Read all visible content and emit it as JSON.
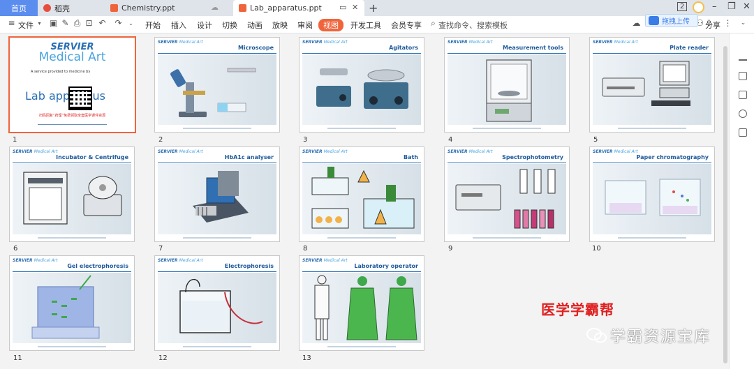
{
  "tabs": {
    "home": "首页",
    "daoke": "稻壳",
    "doc1": "Chemistry.ppt",
    "doc2": "Lab_apparatus.ppt"
  },
  "titlebar": {
    "badge": "2"
  },
  "ribbon": {
    "file": "文件",
    "tabs": [
      "开始",
      "插入",
      "设计",
      "切换",
      "动画",
      "放映",
      "审阅",
      "视图",
      "开发工具",
      "会员专享"
    ],
    "active_tab": "视图",
    "search_placeholder": "查找命令、搜索模板",
    "upload_label": "拖拽上传",
    "share": "分享"
  },
  "cover": {
    "servier": "SERVIER",
    "medical_art": "Medical Art",
    "tagline": "A service provided to medicine by",
    "lab_title": "Lab apparatus",
    "promo": "扫码回复“药理”免费领取全套医学课件资源"
  },
  "slides": [
    {
      "num": "1",
      "title": ""
    },
    {
      "num": "2",
      "title": "Microscope"
    },
    {
      "num": "3",
      "title": "Agitators"
    },
    {
      "num": "4",
      "title": "Measurement tools"
    },
    {
      "num": "5",
      "title": "Plate reader"
    },
    {
      "num": "6",
      "title": "Incubator & Centrifuge"
    },
    {
      "num": "7",
      "title": "HbA1c analyser"
    },
    {
      "num": "8",
      "title": "Bath"
    },
    {
      "num": "9",
      "title": "Spectrophotometry"
    },
    {
      "num": "10",
      "title": "Paper chromatography"
    },
    {
      "num": "11",
      "title": "Gel electrophoresis"
    },
    {
      "num": "12",
      "title": "Electrophoresis"
    },
    {
      "num": "13",
      "title": "Laboratory operator"
    }
  ],
  "slide_logo": {
    "bold": "SERVIER",
    "lite": "Medical Art"
  },
  "watermarks": {
    "red": "医学学霸帮",
    "wechat": "学霸资源宝库"
  },
  "colors": {
    "accent": "#f0643c",
    "home_tab": "#5b8def",
    "servier_blue": "#2a6fb5",
    "watermark_red": "#e02020"
  }
}
